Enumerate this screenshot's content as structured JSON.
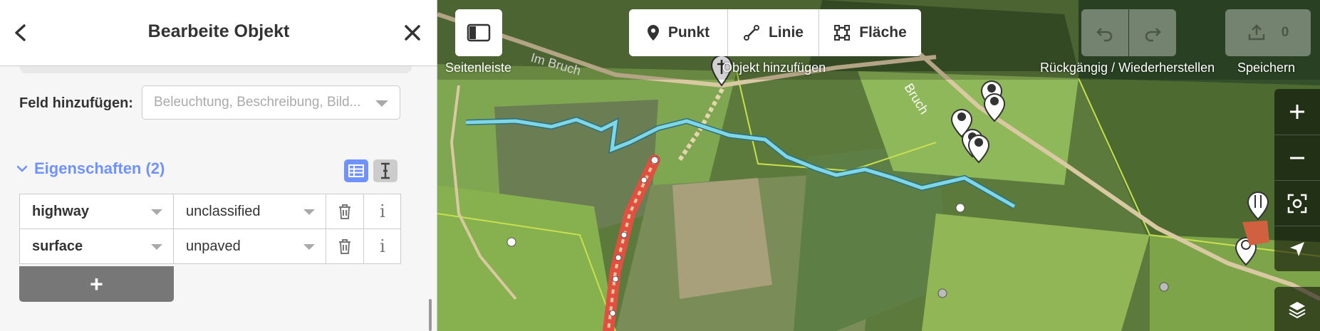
{
  "sidebar": {
    "title": "Bearbeite Objekt",
    "add_field_label": "Feld hinzufügen:",
    "add_field_placeholder": "Beleuchtung, Beschreibung, Bild...",
    "section_title": "Eigenschaften (2)",
    "tags": [
      {
        "key": "highway",
        "value": "unclassified"
      },
      {
        "key": "surface",
        "value": "unpaved"
      }
    ],
    "add_tag_label": "+",
    "info_glyph": "i"
  },
  "toolbar": {
    "sidebar_toggle_caption": "Seitenleiste",
    "add_object_caption": "Objekt hinzufügen",
    "modes": [
      {
        "label": "Punkt",
        "icon": "point-icon"
      },
      {
        "label": "Linie",
        "icon": "line-icon"
      },
      {
        "label": "Fläche",
        "icon": "area-icon"
      }
    ],
    "undo_redo_caption": "Rückgängig / Wiederherstellen",
    "save_caption": "Speichern",
    "save_count": "0"
  },
  "map": {
    "street_labels": [
      "Im Bruch",
      "Bruch"
    ]
  },
  "colors": {
    "accent": "#7092ff",
    "selected_way": "#e05040",
    "stream": "#7fd6e6"
  }
}
